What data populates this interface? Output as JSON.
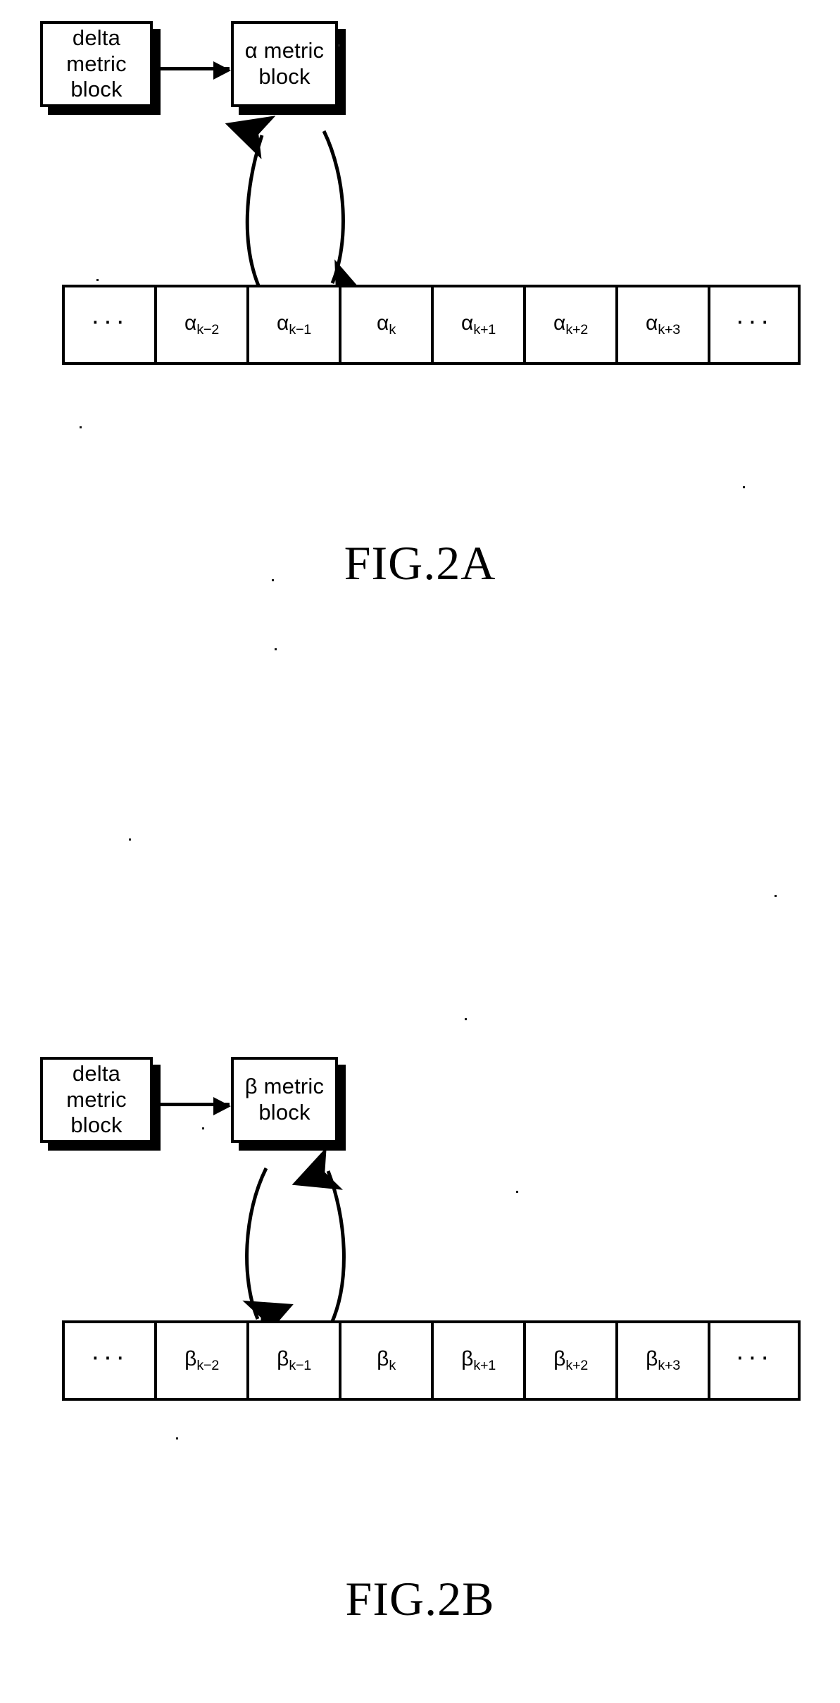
{
  "page": {
    "background_color": "#ffffff",
    "ink_color": "#000000"
  },
  "figures": [
    {
      "id": "fig-2a",
      "caption": "FIG.2A",
      "source_block": {
        "label_lines": [
          "delta",
          "metric",
          "block"
        ],
        "label": "delta metric block"
      },
      "processor_block": {
        "label_lines": [
          "α metric",
          "block"
        ],
        "label": "α metric block",
        "symbol": "α"
      },
      "feed_arrow": {
        "from": "delta metric block",
        "to": "α metric block",
        "direction": "right"
      },
      "array": {
        "name": "alpha-metric-array",
        "cells": [
          {
            "id": "alpha-left-ellipsis",
            "base": "···",
            "sub": "",
            "ellipsis": true
          },
          {
            "id": "alpha-k-minus-2",
            "base": "α",
            "sub": "k−2",
            "ellipsis": false
          },
          {
            "id": "alpha-k-minus-1",
            "base": "α",
            "sub": "k−1",
            "ellipsis": false
          },
          {
            "id": "alpha-k",
            "base": "α",
            "sub": "k",
            "ellipsis": false
          },
          {
            "id": "alpha-k-plus-1",
            "base": "α",
            "sub": "k+1",
            "ellipsis": false
          },
          {
            "id": "alpha-k-plus-2",
            "base": "α",
            "sub": "k+2",
            "ellipsis": false
          },
          {
            "id": "alpha-k-plus-3",
            "base": "α",
            "sub": "k+3",
            "ellipsis": false
          },
          {
            "id": "alpha-right-ellipsis",
            "base": "···",
            "sub": "",
            "ellipsis": true
          }
        ]
      },
      "curved_arrows": [
        {
          "id": "read-arrow",
          "from": "αₖ",
          "to": "α metric block",
          "direction": "up"
        },
        {
          "id": "write-arrow",
          "from": "α metric block",
          "to": "αₖ₊₁",
          "direction": "down"
        }
      ]
    },
    {
      "id": "fig-2b",
      "caption": "FIG.2B",
      "source_block": {
        "label_lines": [
          "delta",
          "metric",
          "block"
        ],
        "label": "delta metric block"
      },
      "processor_block": {
        "label_lines": [
          "β metric",
          "block"
        ],
        "label": "β metric block",
        "symbol": "β"
      },
      "feed_arrow": {
        "from": "delta metric block",
        "to": "β metric block",
        "direction": "right"
      },
      "array": {
        "name": "beta-metric-array",
        "cells": [
          {
            "id": "beta-left-ellipsis",
            "base": "···",
            "sub": "",
            "ellipsis": true
          },
          {
            "id": "beta-k-minus-2",
            "base": "β",
            "sub": "k−2",
            "ellipsis": false
          },
          {
            "id": "beta-k-minus-1",
            "base": "β",
            "sub": "k−1",
            "ellipsis": false
          },
          {
            "id": "beta-k",
            "base": "β",
            "sub": "k",
            "ellipsis": false
          },
          {
            "id": "beta-k-plus-1",
            "base": "β",
            "sub": "k+1",
            "ellipsis": false
          },
          {
            "id": "beta-k-plus-2",
            "base": "β",
            "sub": "k+2",
            "ellipsis": false
          },
          {
            "id": "beta-k-plus-3",
            "base": "β",
            "sub": "k+3",
            "ellipsis": false
          },
          {
            "id": "beta-right-ellipsis",
            "base": "···",
            "sub": "",
            "ellipsis": true
          }
        ]
      },
      "curved_arrows": [
        {
          "id": "write-arrow",
          "from": "β metric block",
          "to": "βₖ",
          "direction": "down"
        },
        {
          "id": "read-arrow",
          "from": "βₖ₊₁",
          "to": "β metric block",
          "direction": "up"
        }
      ]
    }
  ]
}
